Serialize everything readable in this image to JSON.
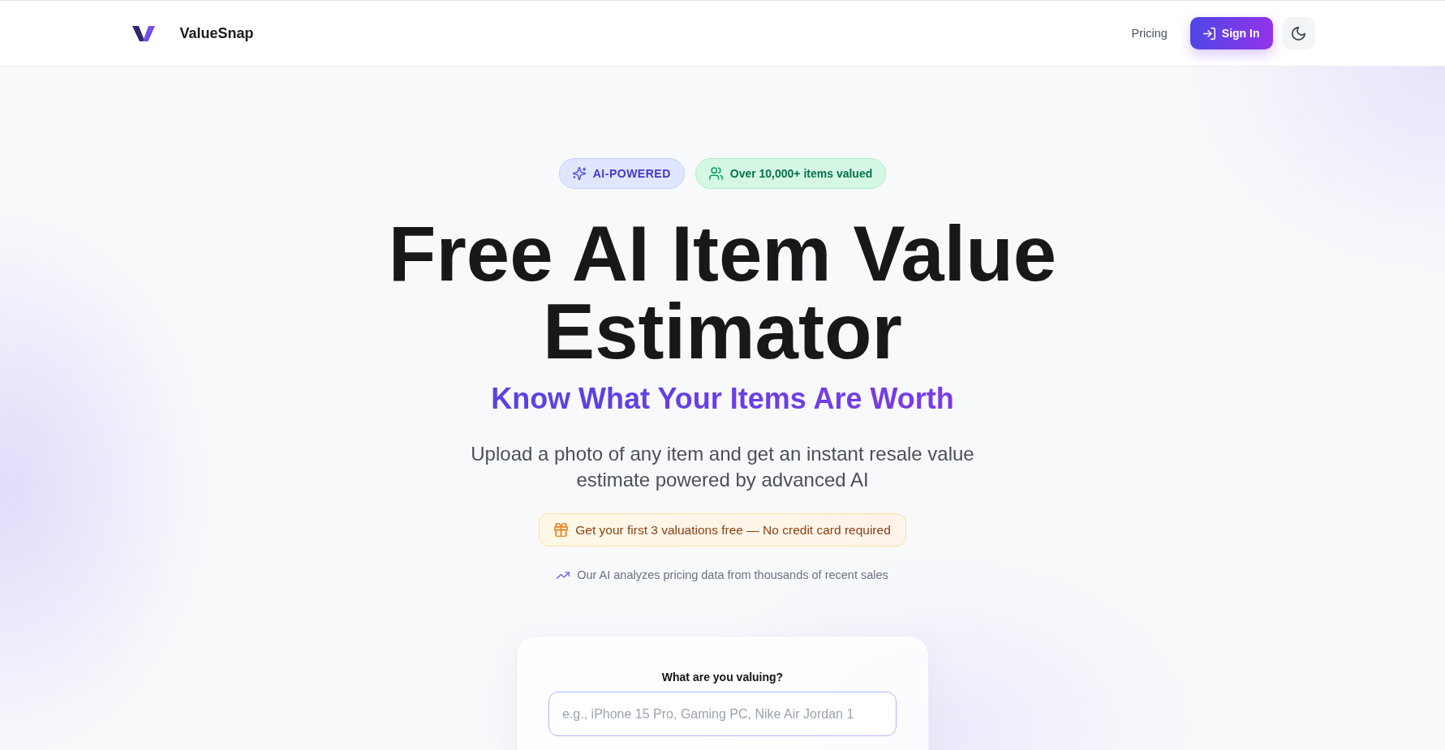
{
  "header": {
    "brand": "ValueSnap",
    "nav": [
      {
        "label": "Pricing"
      }
    ],
    "sign_in": "Sign In"
  },
  "badges": [
    {
      "kind": "feature",
      "label": "AI-POWERED"
    },
    {
      "kind": "stat",
      "label": "Over 10,000+ items valued"
    }
  ],
  "hero": {
    "title": "Free AI Item Value Estimator",
    "tagline": "Know What Your Items Are Worth",
    "description": "Upload a photo of any item and get an instant resale value estimate powered by advanced AI",
    "offer": "Get your first 3 valuations free — No credit card required",
    "note": "Our AI analyzes pricing data from thousands of recent sales"
  },
  "form": {
    "label": "What are you valuing?",
    "placeholder": "e.g., iPhone 15 Pro, Gaming PC, Nike Air Jordan 1"
  }
}
